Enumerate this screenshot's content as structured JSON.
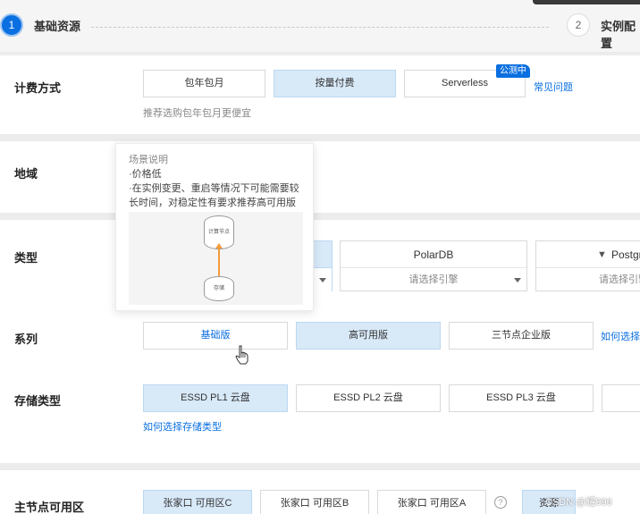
{
  "steps": {
    "step1": {
      "number": "1",
      "label": "基础资源"
    },
    "step2": {
      "number": "2",
      "label": "实例配置"
    }
  },
  "billing": {
    "label": "计费方式",
    "options": [
      "包年包月",
      "按量付费",
      "Serverless"
    ],
    "badge": "公测中",
    "link": "常见问题",
    "hint": "推荐选购包年包月更便宜"
  },
  "region": {
    "label": "地域"
  },
  "tooltip": {
    "title": "场景说明",
    "lines": [
      "·价格低",
      "·在实例变更、重启等情况下可能需要较",
      "长时间，对稳定性有要求推荐高可用版"
    ],
    "diagram": {
      "top": "计算节点",
      "bottom": "存储"
    }
  },
  "type": {
    "label": "类型",
    "cards": [
      {
        "name": "PolarDB",
        "select": "请选择引擎"
      },
      {
        "name": "Postgr",
        "select": "请选择引擎"
      }
    ]
  },
  "series": {
    "label": "系列",
    "options": [
      "基础版",
      "高可用版",
      "三节点企业版"
    ],
    "link": "如何选择"
  },
  "storage": {
    "label": "存储类型",
    "options": [
      "ESSD PL1 云盘",
      "ESSD PL2 云盘",
      "ESSD PL3 云盘"
    ],
    "link": "如何选择存储类型"
  },
  "zone": {
    "label": "主节点可用区",
    "options": [
      "张家口 可用区C",
      "张家口 可用区B",
      "张家口 可用区A"
    ],
    "help": "?",
    "extra": "资源"
  },
  "watermark": "CSDN @耀996",
  "colors": {
    "accent": "#0a6fe0",
    "selected": "#d8e9f8"
  }
}
